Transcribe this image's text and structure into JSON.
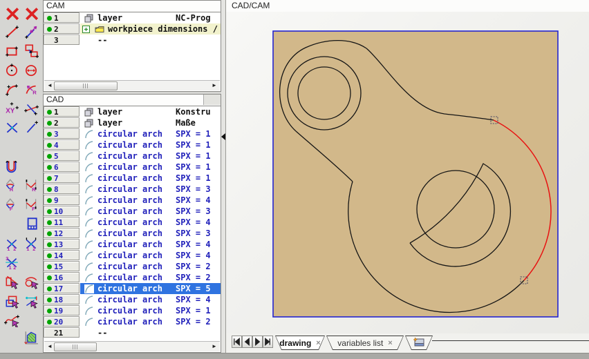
{
  "colors": {
    "workpiece_fill": "#d2b88a",
    "workpiece_border": "#2323d0",
    "selected_arc": "#e81111",
    "selection_row": "#2f73e0",
    "highlight_row": "#f2f2cd",
    "bullet_green": "#00a400",
    "blue_text": "#2222bb",
    "toolbar_red": "#dd2222"
  },
  "toolbar": {
    "icons": [
      {
        "name": "delete-all-icon"
      },
      {
        "name": "delete-element-icon"
      },
      {
        "name": "line-icon"
      },
      {
        "name": "modify-line-icon"
      },
      {
        "name": "rectangle-icon"
      },
      {
        "name": "copy-rectangle-icon"
      },
      {
        "name": "circle-icon"
      },
      {
        "name": "circle-diameter-icon"
      },
      {
        "name": "arc-icon"
      },
      {
        "name": "arc-radius-icon"
      },
      {
        "name": "point-xy-icon"
      },
      {
        "name": "tangent-line-icon"
      },
      {
        "name": "intersection-icon"
      },
      {
        "name": "segment-icon"
      },
      {
        "name": "contour-icon"
      },
      {
        "name": "fillet-radius-icon"
      },
      {
        "name": "corner-radius-icon"
      },
      {
        "name": "fillet-chamfer-icon"
      },
      {
        "name": "corner-chamfer-icon"
      },
      {
        "name": "workpiece-icon"
      },
      {
        "name": "trim-two-icon"
      },
      {
        "name": "trim-extend-icon"
      },
      {
        "name": "trim-three-icon"
      },
      {
        "name": "delete-line-icon"
      },
      {
        "name": "delete-arc-icon"
      },
      {
        "name": "copy-element-icon"
      },
      {
        "name": "measure-icon"
      },
      {
        "name": "select-curve-icon"
      },
      {
        "name": "hatch-area-icon"
      }
    ]
  },
  "cam_panel": {
    "title": "CAM",
    "rows": [
      {
        "num": "1",
        "bullet": true,
        "icon": "layers",
        "label": "layer",
        "value": "NC-Prog"
      },
      {
        "num": "2",
        "bullet": true,
        "expand": true,
        "icon": "folder",
        "label": "workpiece dimensions /",
        "highlighted": true
      },
      {
        "num": "3",
        "bullet": false,
        "label": "--",
        "dash": true
      }
    ]
  },
  "cad_panel": {
    "title": "CAD",
    "rows": [
      {
        "num": "1",
        "bullet": true,
        "icon": "layers",
        "label": "layer",
        "value": "Konstru"
      },
      {
        "num": "2",
        "bullet": true,
        "icon": "layers",
        "label": "layer",
        "value": "Maße"
      },
      {
        "num": "3",
        "bullet": true,
        "icon": "arc",
        "label": "circular arch",
        "value": "SPX = 1",
        "blue": true
      },
      {
        "num": "4",
        "bullet": true,
        "icon": "arc",
        "label": "circular arch",
        "value": "SPX = 1",
        "blue": true
      },
      {
        "num": "5",
        "bullet": true,
        "icon": "arc",
        "label": "circular arch",
        "value": "SPX = 1",
        "blue": true
      },
      {
        "num": "6",
        "bullet": true,
        "icon": "arc",
        "label": "circular arch",
        "value": "SPX = 1",
        "blue": true
      },
      {
        "num": "7",
        "bullet": true,
        "icon": "arc",
        "label": "circular arch",
        "value": "SPX = 1",
        "blue": true
      },
      {
        "num": "8",
        "bullet": true,
        "icon": "arc",
        "label": "circular arch",
        "value": "SPX = 3",
        "blue": true
      },
      {
        "num": "9",
        "bullet": true,
        "icon": "arc",
        "label": "circular arch",
        "value": "SPX = 4",
        "blue": true
      },
      {
        "num": "10",
        "bullet": true,
        "icon": "arc",
        "label": "circular arch",
        "value": "SPX = 3",
        "blue": true
      },
      {
        "num": "11",
        "bullet": true,
        "icon": "arc",
        "label": "circular arch",
        "value": "SPX = 4",
        "blue": true
      },
      {
        "num": "12",
        "bullet": true,
        "icon": "arc",
        "label": "circular arch",
        "value": "SPX = 3",
        "blue": true
      },
      {
        "num": "13",
        "bullet": true,
        "icon": "arc",
        "label": "circular arch",
        "value": "SPX = 4",
        "blue": true
      },
      {
        "num": "14",
        "bullet": true,
        "icon": "arc",
        "label": "circular arch",
        "value": "SPX = 4",
        "blue": true
      },
      {
        "num": "15",
        "bullet": true,
        "icon": "arc",
        "label": "circular arch",
        "value": "SPX = 2",
        "blue": true
      },
      {
        "num": "16",
        "bullet": true,
        "icon": "arc",
        "label": "circular arch",
        "value": "SPX = 2",
        "blue": true
      },
      {
        "num": "17",
        "bullet": true,
        "icon": "arc",
        "label": "circular arch",
        "value": "SPX = 5",
        "blue": true,
        "selected": true
      },
      {
        "num": "18",
        "bullet": true,
        "icon": "arc",
        "label": "circular arch",
        "value": "SPX = 4",
        "blue": true
      },
      {
        "num": "19",
        "bullet": true,
        "icon": "arc",
        "label": "circular arch",
        "value": "SPX = 1",
        "blue": true
      },
      {
        "num": "20",
        "bullet": true,
        "icon": "arc",
        "label": "circular arch",
        "value": "SPX = 2",
        "blue": true
      },
      {
        "num": "21",
        "bullet": false,
        "label": "--",
        "dash": true
      }
    ]
  },
  "main": {
    "title": "CAD/CAM",
    "nav_buttons": [
      {
        "name": "first"
      },
      {
        "name": "prev"
      },
      {
        "name": "next"
      },
      {
        "name": "last"
      }
    ],
    "tabs": [
      {
        "label": "drawing",
        "close": "×",
        "active": true
      },
      {
        "label": "variables list",
        "close": "×",
        "active": false
      },
      {
        "icon": "new-view-icon",
        "active": false
      }
    ]
  }
}
